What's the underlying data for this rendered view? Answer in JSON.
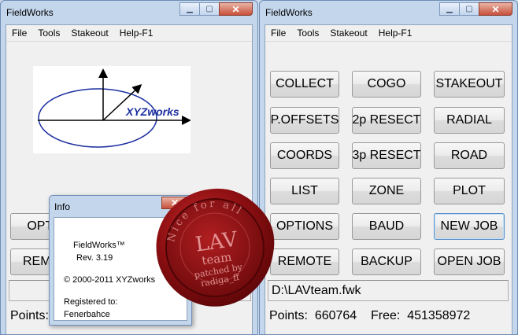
{
  "left_window": {
    "title": "FieldWorks",
    "menu": [
      "File",
      "Tools",
      "Stakeout",
      "Help-F1"
    ],
    "logo_text": "XYZworks",
    "buttons": {
      "options_partial": "OPTI",
      "remote_partial": "REMO"
    },
    "status": {
      "points_label": "Points:"
    }
  },
  "right_window": {
    "title": "FieldWorks",
    "menu": [
      "File",
      "Tools",
      "Stakeout",
      "Help-F1"
    ],
    "buttons": [
      [
        "COLLECT",
        "COGO",
        "STAKEOUT"
      ],
      [
        "P.OFFSETS",
        "2p RESECT",
        "RADIAL"
      ],
      [
        "COORDS",
        "3p RESECT",
        "ROAD"
      ],
      [
        "LIST",
        "ZONE",
        "PLOT"
      ],
      [
        "OPTIONS",
        "BAUD",
        "NEW JOB"
      ],
      [
        "REMOTE",
        "BACKUP",
        "OPEN JOB"
      ]
    ],
    "job_file": "D:\\LAVteam.fwk",
    "status": {
      "points_label": "Points:",
      "points_value": "660764",
      "free_label": "Free:",
      "free_value": "451358972"
    }
  },
  "info_dialog": {
    "title": "Info",
    "product": "FieldWorks™",
    "rev": "Rev. 3.19",
    "copyright": "© 2000-2011 XYZworks",
    "registered_label": "Registered to:",
    "registered_to": "Fenerbahce"
  },
  "seal": {
    "ring_text": "Nice for all",
    "center_text": "LAV",
    "sub_text": "team",
    "patched_line1": "patched by",
    "patched_line2": "radiga_ff"
  },
  "colors": {
    "logo_ellipse": "#1c2fa0",
    "logo_text": "#1c2fa0",
    "seal_red": "#8e0f12",
    "close_button": "#c8503b"
  }
}
